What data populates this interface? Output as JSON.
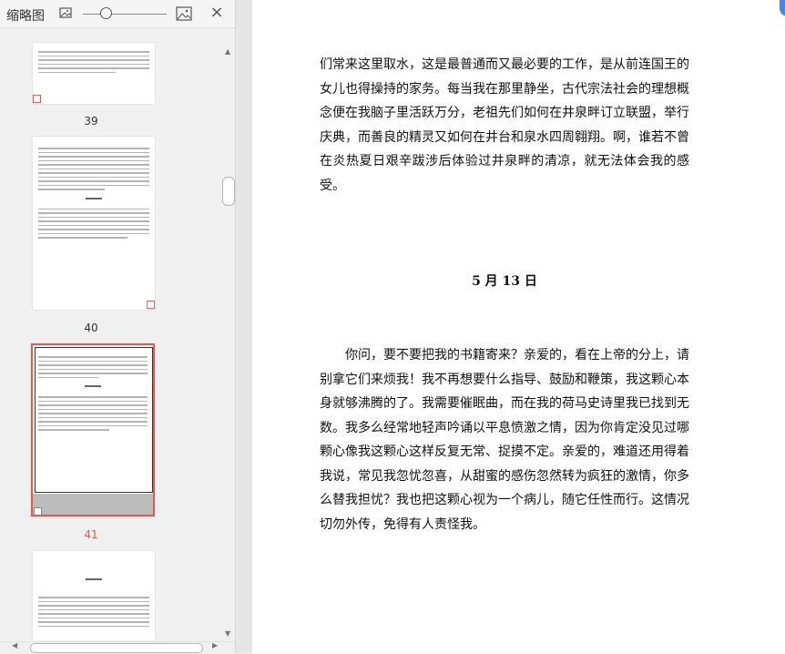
{
  "toolbar": {
    "title": "缩略图",
    "icons": [
      "image-small-icon",
      "image-large-icon",
      "close-icon"
    ],
    "close_glyph": "×"
  },
  "thumbnails": [
    {
      "number": "39",
      "selected": false
    },
    {
      "number": "40",
      "selected": false,
      "heading": "5月13日"
    },
    {
      "number": "41",
      "selected": true,
      "heading": "5月15日"
    },
    {
      "number": "",
      "selected": false,
      "heading": "5月17日"
    }
  ],
  "scroll": {
    "up": "▲",
    "down": "▼",
    "left": "◀",
    "right": "▶"
  },
  "document": {
    "para1": "们常来这里取水，这是最普通而又最必要的工作，是从前连国王的女儿也得操持的家务。每当我在那里静坐，古代宗法社会的理想概念便在我脑子里活跃万分，老祖先们如何在井泉畔订立联盟，举行庆典，而善良的精灵又如何在井台和泉水四周翱翔。啊，谁若不曾在炎热夏日艰辛跋涉后体验过井泉畔的清凉，就无法体会我的感受。",
    "heading": "5 月 13 日",
    "para2": "你问，要不要把我的书籍寄来？亲爱的，看在上帝的分上，请别拿它们来烦我！我不再想要什么指导、鼓励和鞭策，我这颗心本身就够沸腾的了。我需要催眠曲，而在我的荷马史诗里我已找到无数。我多么经常地轻声吟诵以平息愤激之情，因为你肯定没见过哪颗心像我这颗心这样反复无常、捉摸不定。亲爱的，难道还用得着我说，常见我忽忧忽喜，从甜蜜的感伤忽然转为疯狂的激情，你多么替我担忧？我也把这颗心视为一个病儿，随它任性而行。这情况切勿外传，免得有人责怪我。"
  },
  "colors": {
    "selected_border": "#e05a5a",
    "selected_number": "#e05a5a",
    "accent": "#4a86e8"
  }
}
